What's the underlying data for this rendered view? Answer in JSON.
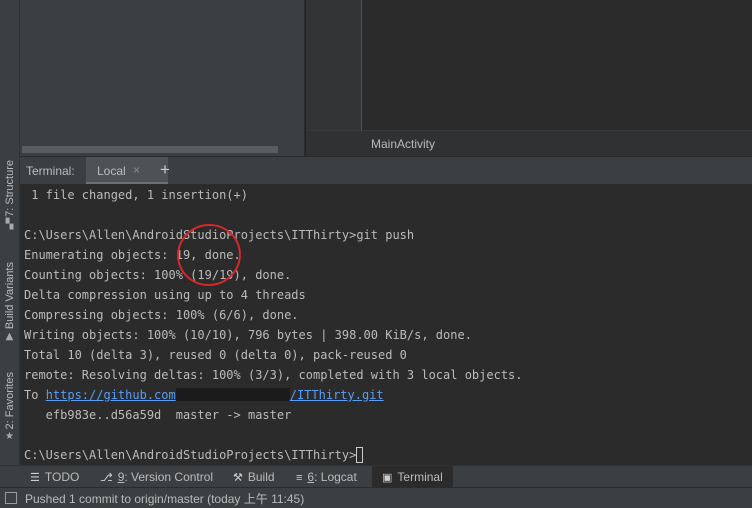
{
  "left_toolwindows": [
    {
      "label": "7: Structure",
      "icon": "structure-icon"
    },
    {
      "label": "Build Variants",
      "icon": "android-icon"
    },
    {
      "label": "2: Favorites",
      "icon": "star-icon"
    }
  ],
  "editor": {
    "breadcrumb": "MainActivity"
  },
  "terminal": {
    "title": "Terminal:",
    "tab_label": "Local",
    "close_glyph": "×",
    "add_glyph": "+",
    "lines": {
      "l0": " 1 file changed, 1 insertion(+)",
      "l2": "C:\\Users\\Allen\\AndroidStudioProjects\\ITThirty>git push",
      "l3": "Enumerating objects: 19, done.",
      "l4": "Counting objects: 100% (19/19), done.",
      "l5": "Delta compression using up to 4 threads",
      "l6": "Compressing objects: 100% (6/6), done.",
      "l7": "Writing objects: 100% (10/10), 796 bytes | 398.00 KiB/s, done.",
      "l8": "Total 10 (delta 3), reused 0 (delta 0), pack-reused 0",
      "l9": "remote: Resolving deltas: 100% (3/3), completed with 3 local objects.",
      "l10_prefix": "To ",
      "l10_link_a": "https://github.com",
      "l10_link_b": "/ITThirty.git",
      "l11": "   efb983e..d56a59d  master -> master",
      "l13": "C:\\Users\\Allen\\AndroidStudioProjects\\ITThirty>"
    },
    "annotation_color": "#d22a2a"
  },
  "bottom_tabs": [
    {
      "label": "TODO",
      "icon": "todo-icon"
    },
    {
      "label_num": "9",
      "label_rest": ": Version Control",
      "icon": "vcs-icon"
    },
    {
      "label": "Build",
      "icon": "hammer-icon"
    },
    {
      "label_num": "6",
      "label_rest": ": Logcat",
      "icon": "logcat-icon"
    },
    {
      "label": "Terminal",
      "icon": "terminal-icon",
      "active": true
    }
  ],
  "status": {
    "message": "Pushed 1 commit to origin/master (today 上午 11:45)"
  },
  "colors": {
    "background": "#2b2b2b",
    "panel": "#3c3f41",
    "link": "#589df6"
  }
}
